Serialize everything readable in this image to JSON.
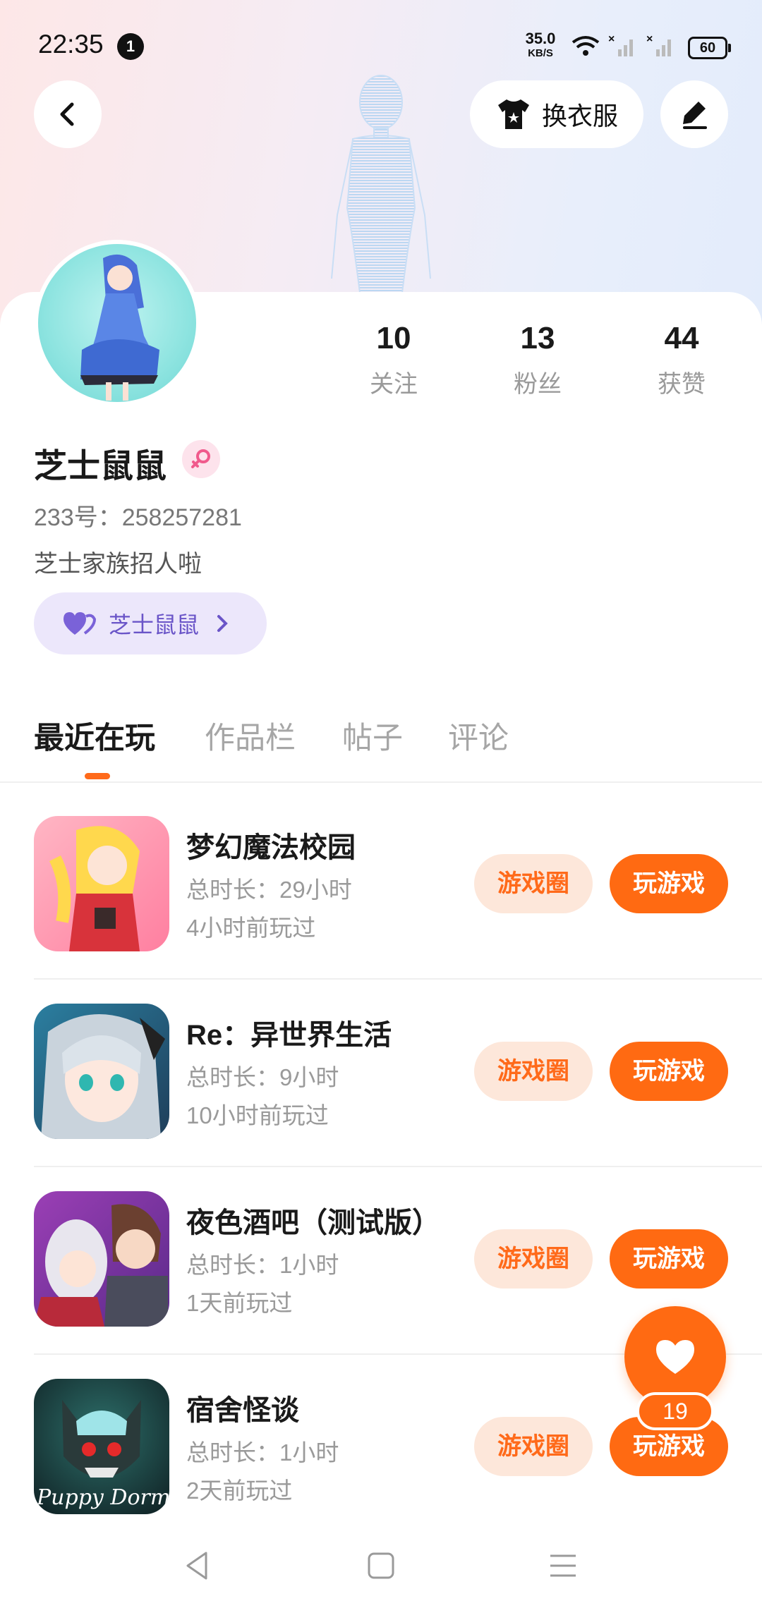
{
  "status_bar": {
    "time": "22:35",
    "notification_count": "1",
    "net_speed_value": "35.0",
    "net_speed_unit": "KB/S",
    "battery": "60"
  },
  "header": {
    "dress_up_label": "换衣服"
  },
  "profile": {
    "stats": [
      {
        "value": "10",
        "label": "关注"
      },
      {
        "value": "13",
        "label": "粉丝"
      },
      {
        "value": "44",
        "label": "获赞"
      }
    ],
    "username": "芝士鼠鼠",
    "uid": "233号：258257281",
    "bio": "芝士家族招人啦",
    "family_chip_label": "芝士鼠鼠"
  },
  "tabs": [
    {
      "label": "最近在玩",
      "active": true
    },
    {
      "label": "作品栏",
      "active": false
    },
    {
      "label": "帖子",
      "active": false
    },
    {
      "label": "评论",
      "active": false
    }
  ],
  "games": [
    {
      "title": "梦幻魔法校园",
      "duration": "总时长：29小时",
      "last_played": "4小时前玩过",
      "circle_label": "游戏圈",
      "play_label": "玩游戏"
    },
    {
      "title": "Re：异世界生活",
      "duration": "总时长：9小时",
      "last_played": "10小时前玩过",
      "circle_label": "游戏圈",
      "play_label": "玩游戏"
    },
    {
      "title": "夜色酒吧（测试版）",
      "duration": "总时长：1小时",
      "last_played": "1天前玩过",
      "circle_label": "游戏圈",
      "play_label": "玩游戏"
    },
    {
      "title": "宿舍怪谈",
      "duration": "总时长：1小时",
      "last_played": "2天前玩过",
      "circle_label": "游戏圈",
      "play_label": "玩游戏",
      "icon_text": "Puppy Dorm"
    }
  ],
  "like_fab": {
    "count": "19"
  },
  "colors": {
    "accent": "#ff6a12",
    "accent_soft": "#fde7da",
    "family_chip_bg": "#ece7fb",
    "family_chip_text": "#6a55c8"
  },
  "icons": {
    "back": "chevron-left-icon",
    "dress": "shirt-icon",
    "edit": "pen-icon",
    "gender": "female-icon",
    "family": "heart-pair-icon",
    "like": "heart-icon"
  }
}
